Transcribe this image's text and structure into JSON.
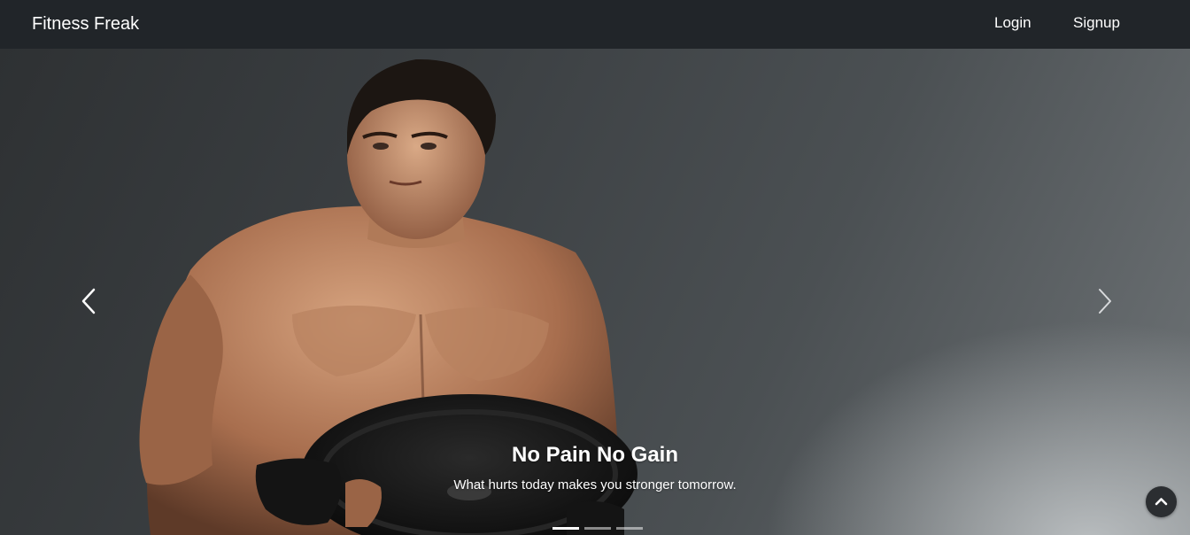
{
  "navbar": {
    "brand": "Fitness Freak",
    "links": [
      "Login",
      "Signup"
    ]
  },
  "carousel": {
    "slide_image": "athlete-holding-weight-plate",
    "caption_title": "No Pain No Gain",
    "caption_text": "What hurts today makes you stronger tomorrow.",
    "indicator_count": 3,
    "active_index": 0,
    "prev_icon": "chevron-left-icon",
    "next_icon": "chevron-right-icon"
  },
  "back_to_top_icon": "chevron-up-icon",
  "colors": {
    "navbar_bg": "#212529",
    "nav_text": "#ffffff",
    "caption_text": "#ffffff"
  }
}
